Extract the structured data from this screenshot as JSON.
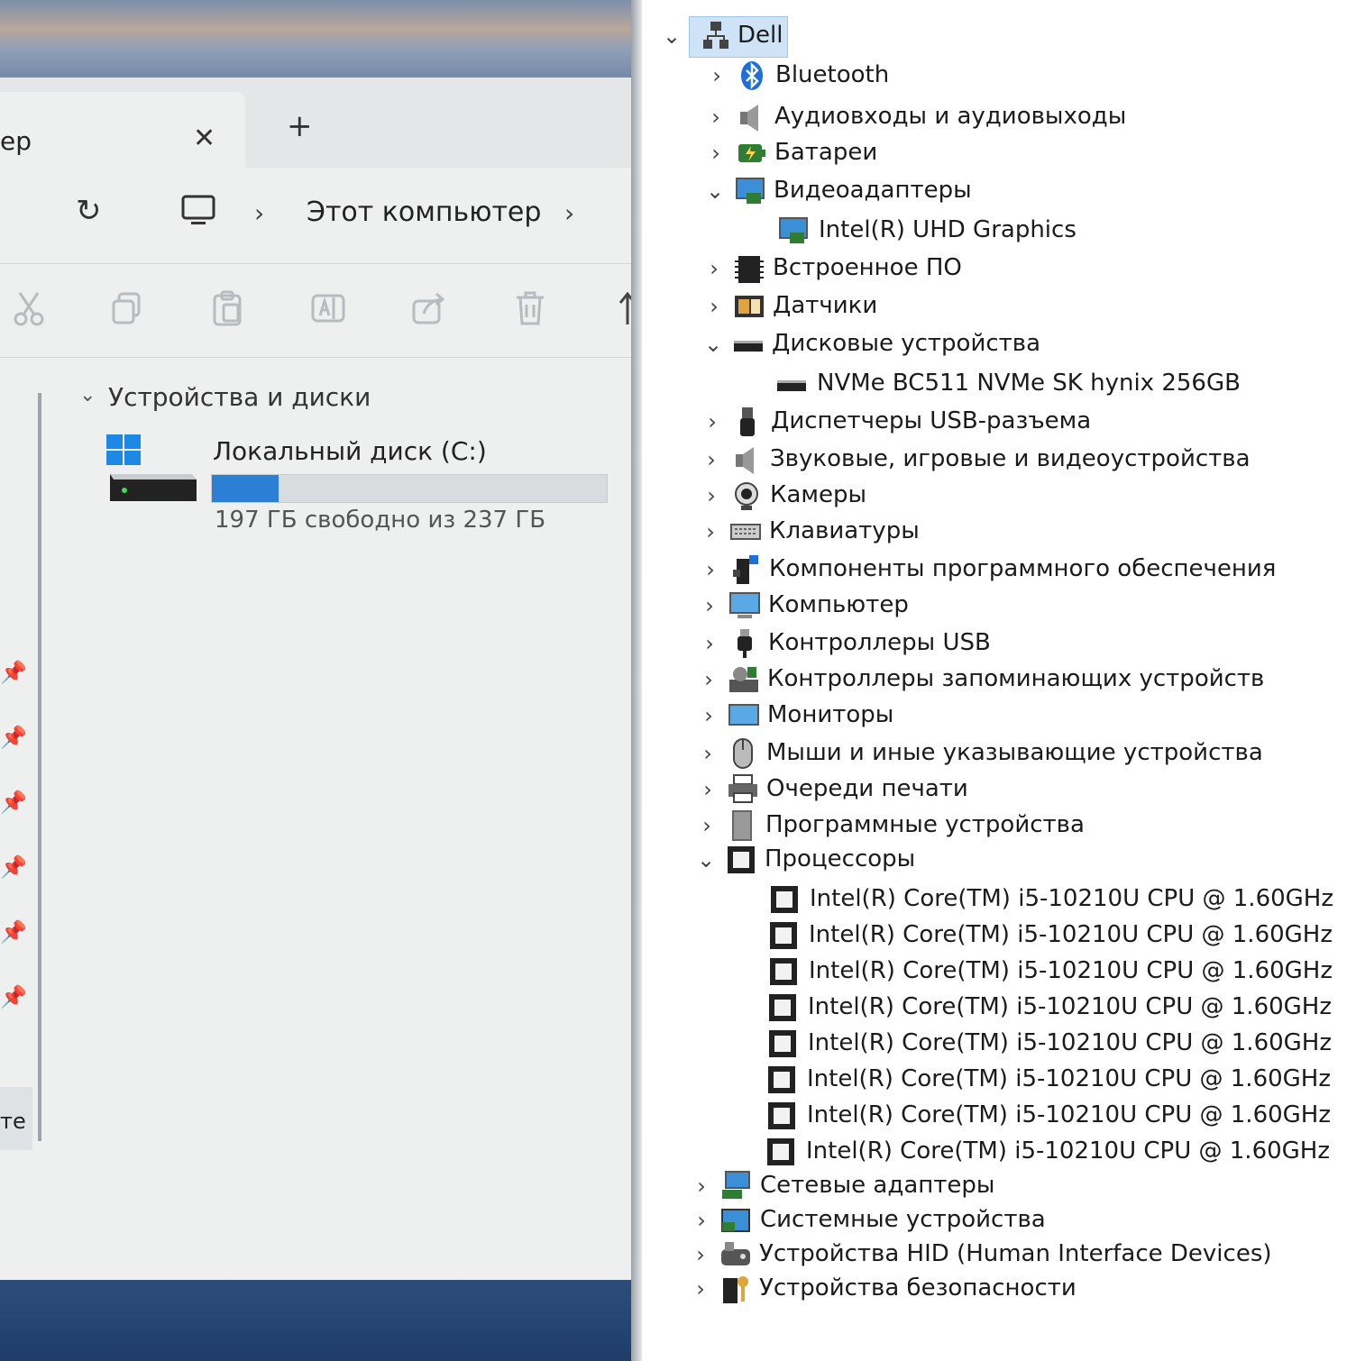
{
  "explorer": {
    "tab_title": "ер",
    "tab_close": "✕",
    "tab_new": "+",
    "refresh_glyph": "↻",
    "crumb_sep": "›",
    "breadcrumb": "Этот компьютер",
    "group_title": "Устройства и диски",
    "group_chevron": "⌄",
    "drive": {
      "name": "Локальный диск (C:)",
      "free_text": "197 ГБ свободно из 237 ГБ",
      "used_fraction": 0.17
    },
    "sidebar_truncated": "те",
    "toolbar_icons": [
      "cut-icon",
      "copy-icon",
      "paste-icon",
      "rename-icon",
      "share-icon",
      "delete-icon",
      "sort-icon"
    ]
  },
  "devmgr": {
    "root": "Dell",
    "items": [
      {
        "label": "Bluetooth",
        "icon": "bluetooth-icon",
        "state": "collapsed"
      },
      {
        "label": "Аудиовходы и аудиовыходы",
        "icon": "speaker-icon",
        "state": "collapsed"
      },
      {
        "label": "Батареи",
        "icon": "battery-icon",
        "state": "collapsed"
      },
      {
        "label": "Видеоадаптеры",
        "icon": "display-adapter-icon",
        "state": "expanded"
      },
      {
        "label": "Intel(R) UHD Graphics",
        "icon": "display-adapter-icon",
        "state": "child"
      },
      {
        "label": "Встроенное ПО",
        "icon": "firmware-icon",
        "state": "collapsed"
      },
      {
        "label": "Датчики",
        "icon": "sensor-icon",
        "state": "collapsed"
      },
      {
        "label": "Дисковые устройства",
        "icon": "disk-icon",
        "state": "expanded"
      },
      {
        "label": "NVMe BC511 NVMe SK hynix 256GB",
        "icon": "disk-icon",
        "state": "child"
      },
      {
        "label": "Диспетчеры USB-разъема",
        "icon": "usb-connector-icon",
        "state": "collapsed"
      },
      {
        "label": "Звуковые, игровые и видеоустройства",
        "icon": "speaker-icon",
        "state": "collapsed"
      },
      {
        "label": "Камеры",
        "icon": "camera-icon",
        "state": "collapsed"
      },
      {
        "label": "Клавиатуры",
        "icon": "keyboard-icon",
        "state": "collapsed"
      },
      {
        "label": "Компоненты программного обеспечения",
        "icon": "software-component-icon",
        "state": "collapsed"
      },
      {
        "label": "Компьютер",
        "icon": "computer-icon",
        "state": "collapsed"
      },
      {
        "label": "Контроллеры USB",
        "icon": "usb-icon",
        "state": "collapsed"
      },
      {
        "label": "Контроллеры запоминающих устройств",
        "icon": "storage-controller-icon",
        "state": "collapsed"
      },
      {
        "label": "Мониторы",
        "icon": "monitor-icon",
        "state": "collapsed"
      },
      {
        "label": "Мыши и иные указывающие устройства",
        "icon": "mouse-icon",
        "state": "collapsed"
      },
      {
        "label": "Очереди печати",
        "icon": "printer-icon",
        "state": "collapsed"
      },
      {
        "label": "Программные устройства",
        "icon": "software-device-icon",
        "state": "collapsed"
      },
      {
        "label": "Процессоры",
        "icon": "processor-icon",
        "state": "expanded"
      },
      {
        "label": "Intel(R) Core(TM) i5-10210U CPU @ 1.60GHz",
        "icon": "processor-icon",
        "state": "child"
      },
      {
        "label": "Intel(R) Core(TM) i5-10210U CPU @ 1.60GHz",
        "icon": "processor-icon",
        "state": "child"
      },
      {
        "label": "Intel(R) Core(TM) i5-10210U CPU @ 1.60GHz",
        "icon": "processor-icon",
        "state": "child"
      },
      {
        "label": "Intel(R) Core(TM) i5-10210U CPU @ 1.60GHz",
        "icon": "processor-icon",
        "state": "child"
      },
      {
        "label": "Intel(R) Core(TM) i5-10210U CPU @ 1.60GHz",
        "icon": "processor-icon",
        "state": "child"
      },
      {
        "label": "Intel(R) Core(TM) i5-10210U CPU @ 1.60GHz",
        "icon": "processor-icon",
        "state": "child"
      },
      {
        "label": "Intel(R) Core(TM) i5-10210U CPU @ 1.60GHz",
        "icon": "processor-icon",
        "state": "child"
      },
      {
        "label": "Intel(R) Core(TM) i5-10210U CPU @ 1.60GHz",
        "icon": "processor-icon",
        "state": "child"
      },
      {
        "label": "Сетевые адаптеры",
        "icon": "network-adapter-icon",
        "state": "collapsed"
      },
      {
        "label": "Системные устройства",
        "icon": "system-device-icon",
        "state": "collapsed"
      },
      {
        "label": "Устройства HID (Human Interface Devices)",
        "icon": "hid-icon",
        "state": "collapsed"
      },
      {
        "label": "Устройства безопасности",
        "icon": "security-device-icon",
        "state": "collapsed"
      }
    ]
  }
}
